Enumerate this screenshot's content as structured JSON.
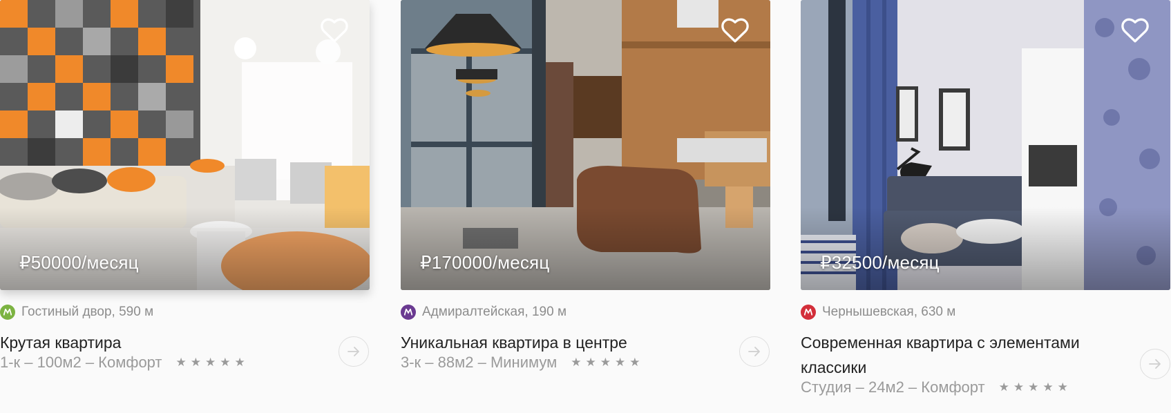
{
  "listings": [
    {
      "price": "₽50000/месяц",
      "metro": {
        "station": "Гостиный двор, 590 м",
        "color": "#7cb342"
      },
      "title": "Крутая квартира",
      "specs": "1-к – 100м2 – Комфорт",
      "rating_stars": "★★★★★",
      "favorite_icon": "heart-outline-icon",
      "open_icon": "arrow-right-icon"
    },
    {
      "price": "₽170000/месяц",
      "metro": {
        "station": "Адмиралтейская, 190 м",
        "color": "#6a3a91"
      },
      "title": "Уникальная квартира в центре",
      "specs": "3-к – 88м2 – Минимум",
      "rating_stars": "★★★★★",
      "favorite_icon": "heart-outline-icon",
      "open_icon": "arrow-right-icon"
    },
    {
      "price": "₽32500/месяц",
      "metro": {
        "station": "Чернышевская, 630 м",
        "color": "#d32f3a"
      },
      "title": "Современная квартира с элементами классики",
      "specs": "Студия – 24м2 – Комфорт",
      "rating_stars": "★★★★★",
      "favorite_icon": "heart-outline-icon",
      "open_icon": "arrow-right-icon"
    }
  ]
}
